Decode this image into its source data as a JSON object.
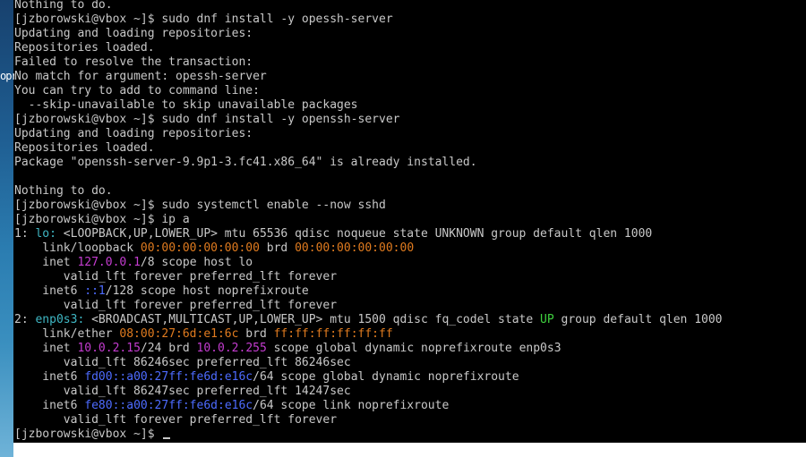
{
  "desktop": {
    "label": "opr"
  },
  "colors": {
    "background": "#000000",
    "text": "#c8c8c8",
    "interface": "#4d6bff",
    "ipv6": "#3fb7c4",
    "mac": "#e07b1f",
    "ipv4": "#c43cd0",
    "state_up": "#3ed13e"
  },
  "terminal": {
    "lines": [
      {
        "segments": [
          {
            "text": "Nothing to do."
          }
        ]
      },
      {
        "segments": [
          {
            "text": "[jzborowski@vbox ~]$ sudo dnf install -y opessh-server"
          }
        ]
      },
      {
        "segments": [
          {
            "text": "Updating and loading repositories:"
          }
        ]
      },
      {
        "segments": [
          {
            "text": "Repositories loaded."
          }
        ]
      },
      {
        "segments": [
          {
            "text": "Failed to resolve the transaction:"
          }
        ]
      },
      {
        "segments": [
          {
            "text": "No match for argument: opessh-server"
          }
        ]
      },
      {
        "segments": [
          {
            "text": "You can try to add to command line:"
          }
        ]
      },
      {
        "segments": [
          {
            "text": "  --skip-unavailable to skip unavailable packages"
          }
        ]
      },
      {
        "segments": [
          {
            "text": "[jzborowski@vbox ~]$ sudo dnf install -y openssh-server"
          }
        ]
      },
      {
        "segments": [
          {
            "text": "Updating and loading repositories:"
          }
        ]
      },
      {
        "segments": [
          {
            "text": "Repositories loaded."
          }
        ]
      },
      {
        "segments": [
          {
            "text": "Package \"openssh-server-9.9p1-3.fc41.x86_64\" is already installed."
          }
        ]
      },
      {
        "segments": [
          {
            "text": ""
          }
        ]
      },
      {
        "segments": [
          {
            "text": "Nothing to do."
          }
        ]
      },
      {
        "segments": [
          {
            "text": "[jzborowski@vbox ~]$ sudo systemctl enable --now sshd"
          }
        ]
      },
      {
        "segments": [
          {
            "text": "[jzborowski@vbox ~]$ ip a"
          }
        ]
      },
      {
        "segments": [
          {
            "text": "1: "
          },
          {
            "text": "lo:",
            "color": "cyan"
          },
          {
            "text": " <LOOPBACK,UP,LOWER_UP> mtu 65536 qdisc noqueue state UNKNOWN group default qlen 1000"
          }
        ]
      },
      {
        "segments": [
          {
            "text": "    link/loopback "
          },
          {
            "text": "00:00:00:00:00:00",
            "color": "orange"
          },
          {
            "text": " brd "
          },
          {
            "text": "00:00:00:00:00:00",
            "color": "orange"
          }
        ]
      },
      {
        "segments": [
          {
            "text": "    inet "
          },
          {
            "text": "127.0.0.1",
            "color": "magenta"
          },
          {
            "text": "/8 scope host lo"
          }
        ]
      },
      {
        "segments": [
          {
            "text": "       valid_lft forever preferred_lft forever"
          }
        ]
      },
      {
        "segments": [
          {
            "text": "    inet6 "
          },
          {
            "text": "::1",
            "color": "blue"
          },
          {
            "text": "/128 scope host noprefixroute"
          }
        ]
      },
      {
        "segments": [
          {
            "text": "       valid_lft forever preferred_lft forever"
          }
        ]
      },
      {
        "segments": [
          {
            "text": "2: "
          },
          {
            "text": "enp0s3:",
            "color": "cyan"
          },
          {
            "text": " <BROADCAST,MULTICAST,UP,LOWER_UP> mtu 1500 qdisc fq_codel state "
          },
          {
            "text": "UP",
            "color": "green"
          },
          {
            "text": " group default qlen 1000"
          }
        ]
      },
      {
        "segments": [
          {
            "text": "    link/ether "
          },
          {
            "text": "08:00:27:6d:e1:6c",
            "color": "orange"
          },
          {
            "text": " brd "
          },
          {
            "text": "ff:ff:ff:ff:ff:ff",
            "color": "orange"
          }
        ]
      },
      {
        "segments": [
          {
            "text": "    inet "
          },
          {
            "text": "10.0.2.15",
            "color": "magenta"
          },
          {
            "text": "/24 brd "
          },
          {
            "text": "10.0.2.255",
            "color": "magenta"
          },
          {
            "text": " scope global dynamic noprefixroute enp0s3"
          }
        ]
      },
      {
        "segments": [
          {
            "text": "       valid_lft 86246sec preferred_lft 86246sec"
          }
        ]
      },
      {
        "segments": [
          {
            "text": "    inet6 "
          },
          {
            "text": "fd00::a00:27ff:fe6d:e16c",
            "color": "blue"
          },
          {
            "text": "/64 scope global dynamic noprefixroute"
          }
        ]
      },
      {
        "segments": [
          {
            "text": "       valid_lft 86247sec preferred_lft 14247sec"
          }
        ]
      },
      {
        "segments": [
          {
            "text": "    inet6 "
          },
          {
            "text": "fe80::a00:27ff:fe6d:e16c",
            "color": "blue"
          },
          {
            "text": "/64 scope link noprefixroute"
          }
        ]
      },
      {
        "segments": [
          {
            "text": "       valid_lft forever preferred_lft forever"
          }
        ]
      },
      {
        "segments": [
          {
            "text": "[jzborowski@vbox ~]$ "
          }
        ],
        "cursor": true
      }
    ]
  }
}
